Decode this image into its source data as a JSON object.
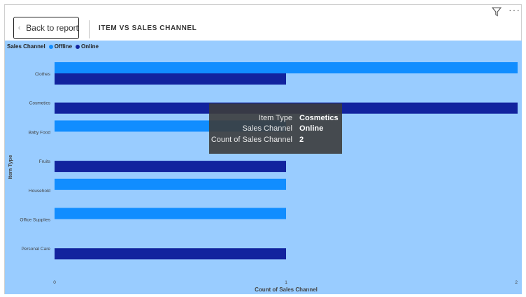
{
  "header": {
    "back_label": "Back to report",
    "page_title": "ITEM VS SALES CHANNEL"
  },
  "icons": {
    "back": "chevron-left-icon",
    "filter": "filter-icon",
    "more": "more-options-icon"
  },
  "colors": {
    "background": "#99ccff",
    "offline": "#118dff",
    "online": "#12239e"
  },
  "legend": {
    "title": "Sales Channel",
    "items": [
      {
        "label": "Offline",
        "color": "#118dff"
      },
      {
        "label": "Online",
        "color": "#12239e"
      }
    ]
  },
  "chart_data": {
    "type": "bar",
    "orientation": "horizontal",
    "categories": [
      "Clothes",
      "Cosmetics",
      "Baby Food",
      "Fruits",
      "Household",
      "Office Supplies",
      "Personal Care"
    ],
    "series": [
      {
        "name": "Offline",
        "values": [
          2,
          0,
          1,
          0,
          1,
          1,
          0
        ]
      },
      {
        "name": "Online",
        "values": [
          1,
          2,
          0,
          1,
          0,
          0,
          1
        ]
      }
    ],
    "xlabel": "Count of Sales Channel",
    "ylabel": "Item Type",
    "xticks": [
      "0",
      "1",
      "2"
    ],
    "xlim": [
      0,
      2
    ],
    "legend_position": "top-left",
    "grid": false
  },
  "tooltip": {
    "rows": [
      {
        "label": "Item Type",
        "value": "Cosmetics"
      },
      {
        "label": "Sales Channel",
        "value": "Online"
      },
      {
        "label": "Count of Sales Channel",
        "value": "2"
      }
    ]
  }
}
